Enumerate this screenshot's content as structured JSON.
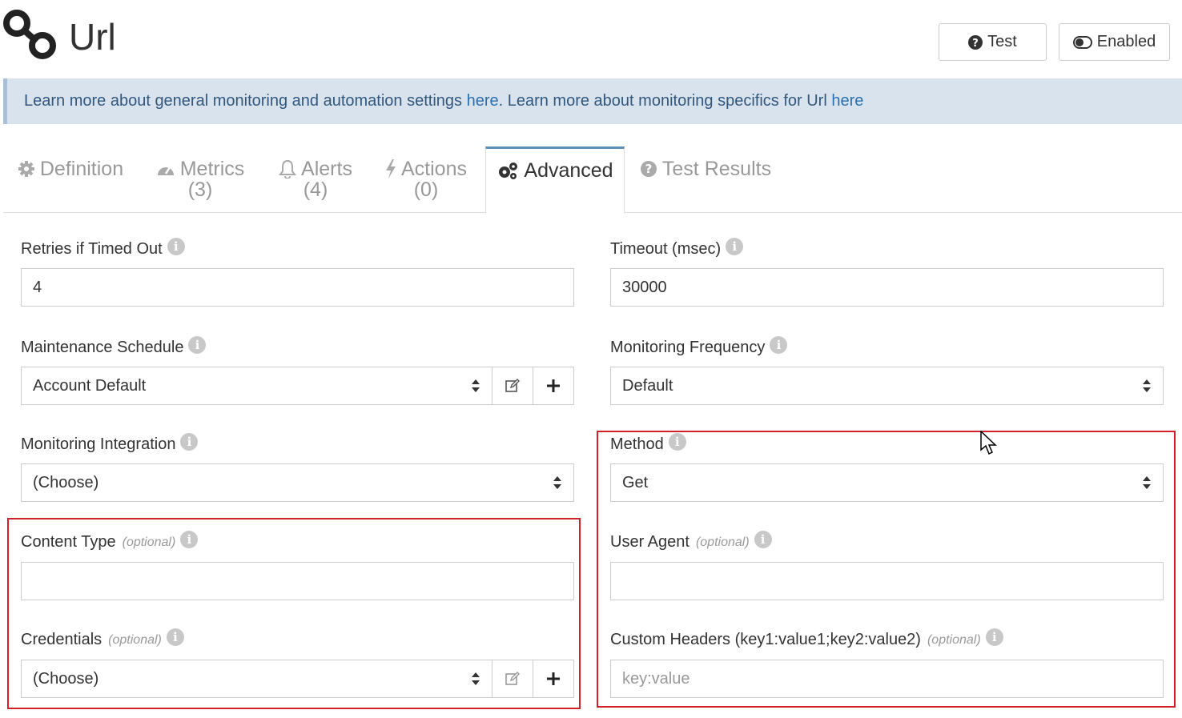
{
  "header": {
    "title": "Url",
    "test_label": "Test",
    "enabled_label": "Enabled",
    "icon": "chain-link-icon"
  },
  "banner": {
    "part1": "Learn more about general monitoring and automation settings ",
    "link1": "here",
    "part2": ". Learn more about monitoring specifics for Url ",
    "link2": "here"
  },
  "tabs": [
    {
      "label": "Definition",
      "count": "",
      "icon": "gear-icon"
    },
    {
      "label": "Metrics",
      "count": "(3)",
      "icon": "dashboard-icon"
    },
    {
      "label": "Alerts",
      "count": "(4)",
      "icon": "bell-icon"
    },
    {
      "label": "Actions",
      "count": "(0)",
      "icon": "bolt-icon"
    },
    {
      "label": "Advanced",
      "count": "",
      "icon": "gears-icon",
      "active": true
    },
    {
      "label": "Test Results",
      "count": "",
      "icon": "question-circle-icon"
    }
  ],
  "form": {
    "retries": {
      "label": "Retries if Timed Out",
      "value": "4"
    },
    "timeout": {
      "label": "Timeout (msec)",
      "value": "30000"
    },
    "maintenance": {
      "label": "Maintenance Schedule",
      "value": "Account Default"
    },
    "frequency": {
      "label": "Monitoring Frequency",
      "value": "Default"
    },
    "integration": {
      "label": "Monitoring Integration",
      "value": "(Choose)"
    },
    "method": {
      "label": "Method",
      "value": "Get"
    },
    "content_type": {
      "label": "Content Type",
      "optional": "(optional)",
      "value": ""
    },
    "user_agent": {
      "label": "User Agent",
      "optional": "(optional)",
      "value": ""
    },
    "credentials": {
      "label": "Credentials",
      "optional": "(optional)",
      "value": "(Choose)"
    },
    "custom_headers": {
      "label": "Custom Headers (key1:value1;key2:value2)",
      "optional": "(optional)",
      "placeholder": "key:value"
    }
  },
  "colors": {
    "highlight": "#d0202a",
    "banner_bg": "#d9e3ed",
    "link": "#2a6fb0",
    "active_tab_border": "#5b8fb8"
  }
}
